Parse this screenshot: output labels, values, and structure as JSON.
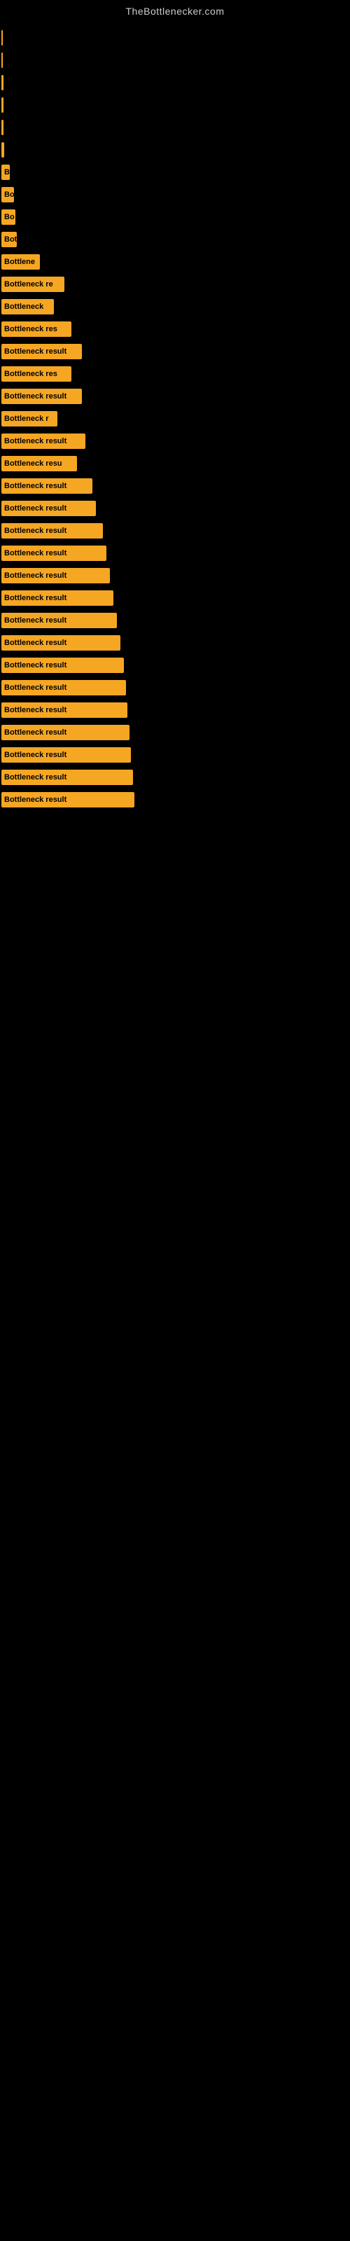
{
  "site": {
    "title": "TheBottlenecker.com"
  },
  "bars": [
    {
      "label": "",
      "width": 2
    },
    {
      "label": "",
      "width": 2
    },
    {
      "label": "",
      "width": 3
    },
    {
      "label": "",
      "width": 3
    },
    {
      "label": "",
      "width": 3
    },
    {
      "label": "",
      "width": 4
    },
    {
      "label": "B",
      "width": 12
    },
    {
      "label": "Bo",
      "width": 18
    },
    {
      "label": "Bo",
      "width": 20
    },
    {
      "label": "Bot",
      "width": 22
    },
    {
      "label": "Bottlene",
      "width": 55
    },
    {
      "label": "Bottleneck re",
      "width": 90
    },
    {
      "label": "Bottleneck",
      "width": 75
    },
    {
      "label": "Bottleneck res",
      "width": 100
    },
    {
      "label": "Bottleneck result",
      "width": 115
    },
    {
      "label": "Bottleneck res",
      "width": 100
    },
    {
      "label": "Bottleneck result",
      "width": 115
    },
    {
      "label": "Bottleneck r",
      "width": 80
    },
    {
      "label": "Bottleneck result",
      "width": 120
    },
    {
      "label": "Bottleneck resu",
      "width": 108
    },
    {
      "label": "Bottleneck result",
      "width": 130
    },
    {
      "label": "Bottleneck result",
      "width": 135
    },
    {
      "label": "Bottleneck result",
      "width": 145
    },
    {
      "label": "Bottleneck result",
      "width": 150
    },
    {
      "label": "Bottleneck result",
      "width": 155
    },
    {
      "label": "Bottleneck result",
      "width": 160
    },
    {
      "label": "Bottleneck result",
      "width": 165
    },
    {
      "label": "Bottleneck result",
      "width": 170
    },
    {
      "label": "Bottleneck result",
      "width": 175
    },
    {
      "label": "Bottleneck result",
      "width": 178
    },
    {
      "label": "Bottleneck result",
      "width": 180
    },
    {
      "label": "Bottleneck result",
      "width": 183
    },
    {
      "label": "Bottleneck result",
      "width": 185
    },
    {
      "label": "Bottleneck result",
      "width": 188
    },
    {
      "label": "Bottleneck result",
      "width": 190
    }
  ]
}
